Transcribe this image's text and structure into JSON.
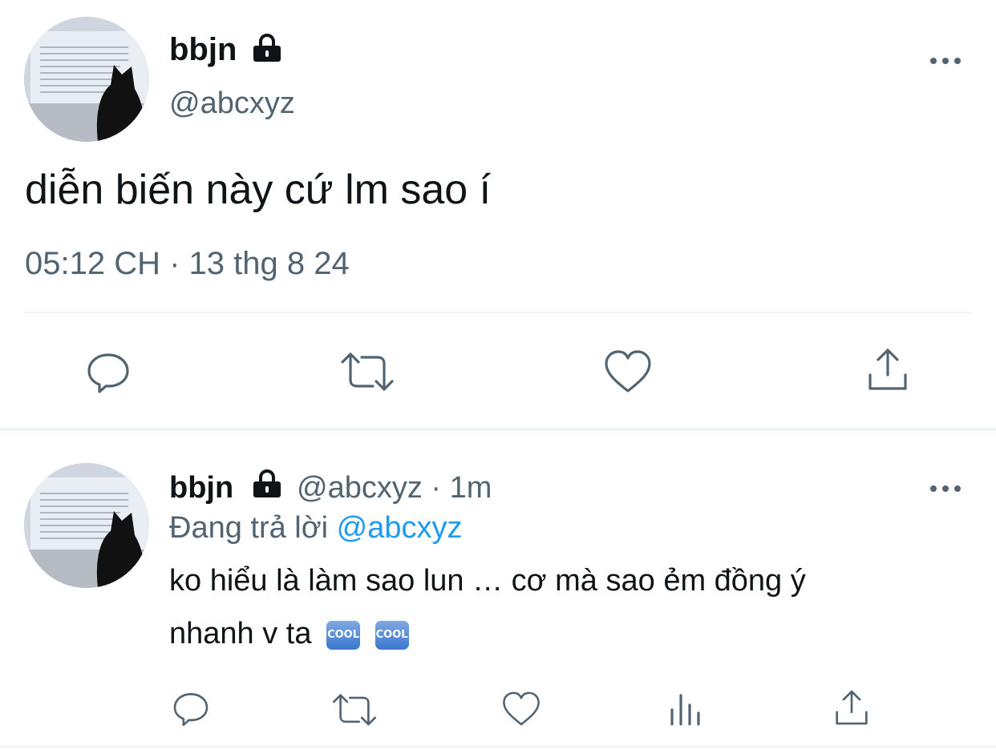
{
  "main_tweet": {
    "display_name": "bbjn",
    "handle": "@abcxyz",
    "text": "diễn biến này cứ lm sao í",
    "timestamp": "05:12 CH · 13 thg 8 24",
    "actions": [
      "reply-icon",
      "retweet-icon",
      "like-icon",
      "share-icon"
    ]
  },
  "reply_tweet": {
    "display_name": "bbjn",
    "handle": "@abcxyz",
    "separator": "·",
    "time_ago": "1m",
    "replying_prefix": "Đang trả lời",
    "replying_to": "@abcxyz",
    "text_line1": "ko hiểu là làm sao lun … cơ mà sao ẻm đồng ý",
    "text_line2": "nhanh v ta",
    "emoji_label": "COOL",
    "actions": [
      "reply-icon",
      "retweet-icon",
      "like-icon",
      "views-icon",
      "share-icon"
    ]
  },
  "colors": {
    "text": "#0f1419",
    "muted": "#536471",
    "link": "#1d9bf0",
    "divider": "#eff3f4"
  }
}
